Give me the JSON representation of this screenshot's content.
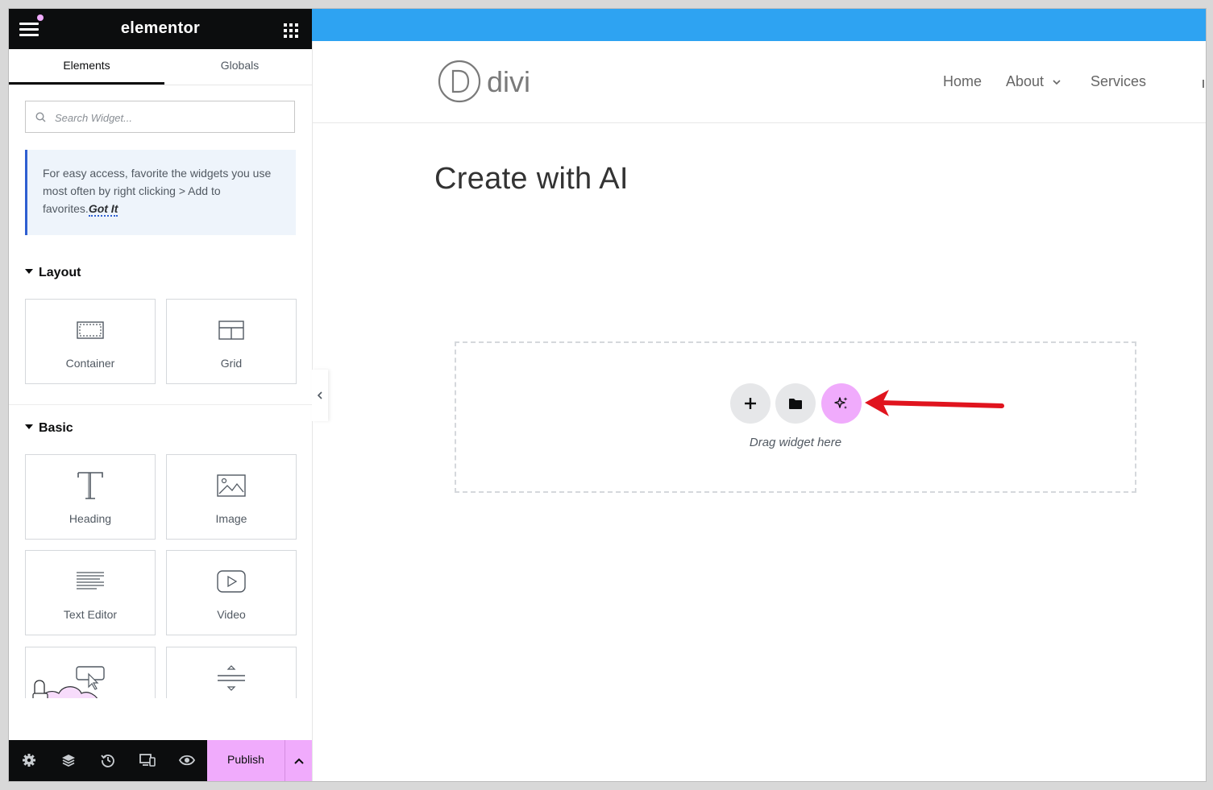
{
  "app": {
    "brand": "elementor"
  },
  "panel": {
    "tabs": [
      {
        "label": "Elements"
      },
      {
        "label": "Globals"
      }
    ],
    "search": {
      "placeholder": "Search Widget..."
    },
    "tip": {
      "text": "For easy access, favorite the widgets you use most often by right clicking > Add to favorites.",
      "action": "Got It"
    },
    "sections": {
      "layout": {
        "title": "Layout",
        "widgets": [
          {
            "label": "Container",
            "icon": "container-icon"
          },
          {
            "label": "Grid",
            "icon": "grid-icon"
          }
        ]
      },
      "basic": {
        "title": "Basic",
        "widgets": [
          {
            "label": "Heading",
            "icon": "heading-icon"
          },
          {
            "label": "Image",
            "icon": "image-icon"
          },
          {
            "label": "Text Editor",
            "icon": "text-editor-icon"
          },
          {
            "label": "Video",
            "icon": "video-icon"
          },
          {
            "label": "",
            "icon": "button-icon"
          },
          {
            "label": "",
            "icon": "divider-icon"
          }
        ]
      }
    },
    "bottom_bar": {
      "icons": [
        "settings-icon",
        "layers-icon",
        "history-icon",
        "responsive-icon",
        "preview-icon"
      ],
      "publish_label": "Publish"
    }
  },
  "canvas": {
    "site_logo": "divi",
    "nav": [
      {
        "label": "Home"
      },
      {
        "label": "About"
      },
      {
        "label": "Services"
      }
    ],
    "page_title": "Create with AI",
    "dropzone": {
      "text": "Drag widget here",
      "buttons": [
        "add-icon",
        "folder-icon",
        "ai-sparkle-icon"
      ]
    }
  },
  "colors": {
    "top_bar": "#2ea3f2",
    "accent_pink": "#f0abfc",
    "annotation_arrow": "#e0141e",
    "panel_dark": "#0c0d0e"
  }
}
